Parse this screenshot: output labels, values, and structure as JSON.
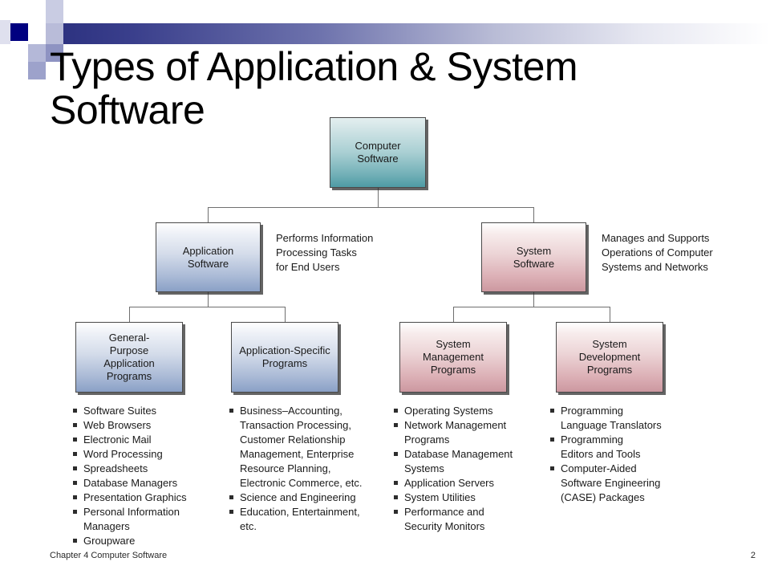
{
  "slide": {
    "title": "Types of Application & System\nSoftware",
    "footer_text": "Chapter 4 Computer Software",
    "page_number": "2"
  },
  "colors": {
    "header_accent": "#2a2f7e",
    "header_square_dark": "#000080",
    "node_teal": "#4e9ba4",
    "node_blue": "#8aa0c6",
    "node_rose": "#cc98a0",
    "connector": "#6f6f6f",
    "text": "#1a1a1a"
  },
  "diagram": {
    "root": {
      "label": "Computer\nSoftware"
    },
    "branches": [
      {
        "label": "Application\nSoftware",
        "caption": "Performs Information\nProcessing Tasks\nfor End Users"
      },
      {
        "label": "System\nSoftware",
        "caption": "Manages and Supports\nOperations of Computer\nSystems and Networks"
      }
    ],
    "leaves": [
      {
        "label": "General-\nPurpose\nApplication\nPrograms"
      },
      {
        "label": "Application-Specific\nPrograms"
      },
      {
        "label": "System\nManagement\nPrograms"
      },
      {
        "label": "System\nDevelopment\nPrograms"
      }
    ]
  },
  "lists": [
    {
      "items": [
        "Software Suites",
        "Web Browsers",
        "Electronic Mail",
        "Word Processing",
        "Spreadsheets",
        "Database Managers",
        "Presentation Graphics",
        "Personal Information\nManagers",
        "Groupware"
      ]
    },
    {
      "items": [
        "Business–Accounting,\nTransaction Processing,\nCustomer Relationship\nManagement, Enterprise\nResource Planning,\nElectronic Commerce, etc.",
        "Science and Engineering",
        "Education, Entertainment,\netc."
      ]
    },
    {
      "items": [
        "Operating Systems",
        "Network Management\nPrograms",
        "Database Management\nSystems",
        "Application Servers",
        "System Utilities",
        "Performance and\nSecurity Monitors"
      ]
    },
    {
      "items": [
        "Programming\nLanguage Translators",
        "Programming\nEditors and Tools",
        "Computer-Aided\nSoftware Engineering\n(CASE) Packages"
      ]
    }
  ]
}
